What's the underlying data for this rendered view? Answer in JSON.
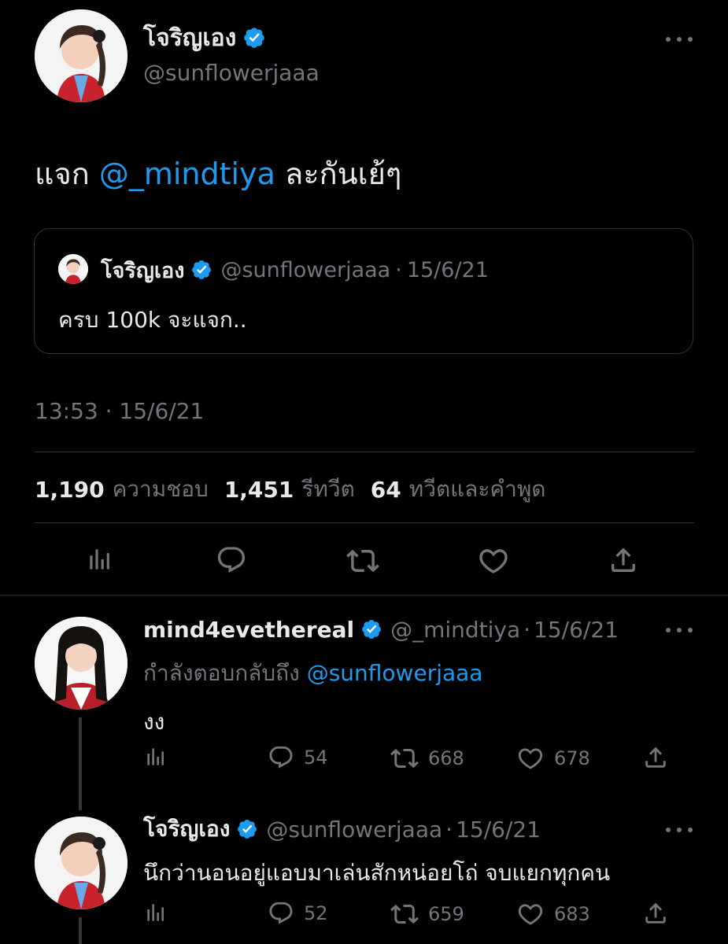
{
  "main_tweet": {
    "author_name": "โจริญเอง",
    "author_handle": "@sunflowerjaaa",
    "text_prefix": "แจก ",
    "mention": "@_mindtiya",
    "text_suffix": " ละกันเย้ๆ",
    "quoted": {
      "author_name": "โจริญเอง",
      "author_handle": "@sunflowerjaaa",
      "date": "15/6/21",
      "text": "ครบ 100k จะแจก.."
    },
    "timestamp": "13:53 · 15/6/21",
    "stats": {
      "likes_count": "1,190",
      "likes_label": "ความชอบ",
      "retweets_count": "1,451",
      "retweets_label": "รีทวีต",
      "quotes_count": "64",
      "quotes_label": "ทวีตและคำพูด"
    }
  },
  "replies": [
    {
      "author_name": "mind4evethereal",
      "author_handle": "@_mindtiya",
      "date": "15/6/21",
      "replying_label": "กำลังตอบกลับถึง ",
      "replying_to": "@sunflowerjaaa",
      "text": "งง",
      "reply_count": "54",
      "retweet_count": "668",
      "like_count": "678"
    },
    {
      "author_name": "โจริญเอง",
      "author_handle": "@sunflowerjaaa",
      "date": "15/6/21",
      "text": "นึกว่านอนอยู่แอบมาเล่นสักหน่อยโถ่ จบแยกทุกคน",
      "reply_count": "52",
      "retweet_count": "659",
      "like_count": "683"
    }
  ],
  "colors": {
    "background": "#000000",
    "text": "#e7e9ea",
    "muted": "#71767b",
    "accent": "#1d9bf0",
    "border": "#2f3336"
  }
}
